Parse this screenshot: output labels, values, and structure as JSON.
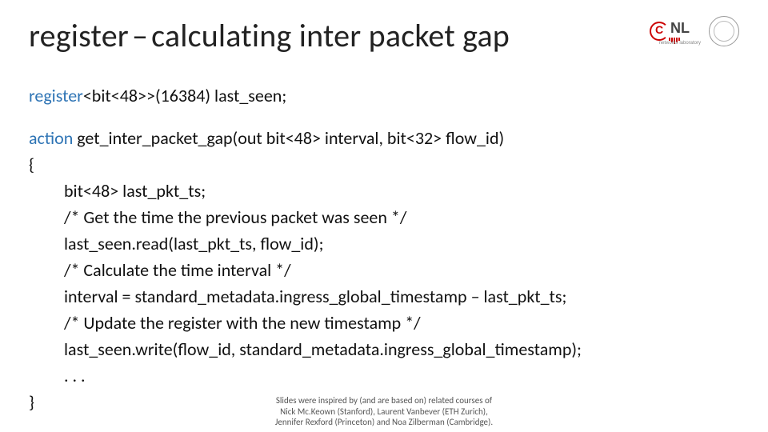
{
  "title": {
    "left": "register",
    "dash": "–",
    "right": "calculating inter packet gap"
  },
  "logos": {
    "cnl_letters_c": "C",
    "cnl_letters_nl": "NL",
    "cnl_sub": "networks laboratory"
  },
  "code": {
    "kw_register": "register",
    "decl_rest": "<bit<48>>(16384) last_seen;",
    "kw_action": "action ",
    "action_sig": "get_inter_packet_gap(out bit<48> interval, bit<32> flow_id)",
    "lbrace": "{",
    "l1": "bit<48> last_pkt_ts;",
    "l2": "/* Get the time the previous packet was seen */",
    "l3": "last_seen.read(last_pkt_ts, flow_id);",
    "l4": "/* Calculate the time interval */",
    "l5": "interval = standard_metadata.ingress_global_timestamp – last_pkt_ts;",
    "l6": "/* Update the register with the new timestamp */",
    "l7": "last_seen.write(flow_id, standard_metadata.ingress_global_timestamp);",
    "l8": ". . .",
    "rbrace": "}"
  },
  "footer": {
    "line1": "Slides were inspired by (and are based on) related courses of",
    "line2": "Nick Mc.Keown (Stanford), Laurent Vanbever (ETH Zurich),",
    "line3": "Jennifer Rexford (Princeton) and Noa Zilberman (Cambridge)."
  }
}
